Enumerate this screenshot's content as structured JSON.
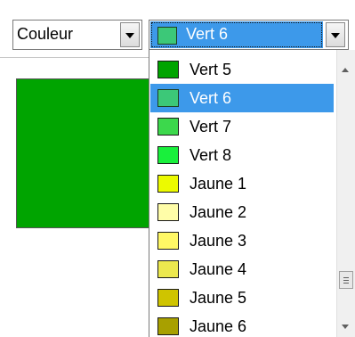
{
  "mode_select": {
    "value": "Couleur"
  },
  "color_select": {
    "value": "Vert 6",
    "swatch": "#3cc878"
  },
  "preview": {
    "color": "#00a400"
  },
  "dropdown": {
    "selected_index": 1,
    "selection_color": "#3d99ea",
    "items": [
      {
        "label": "Vert 5",
        "color": "#00a400"
      },
      {
        "label": "Vert 6",
        "color": "#3cc878"
      },
      {
        "label": "Vert 7",
        "color": "#3cd84c"
      },
      {
        "label": "Vert 8",
        "color": "#19f03c"
      },
      {
        "label": "Jaune 1",
        "color": "#ecfa00"
      },
      {
        "label": "Jaune 2",
        "color": "#fffda8"
      },
      {
        "label": "Jaune 3",
        "color": "#fff865"
      },
      {
        "label": "Jaune 4",
        "color": "#ece84e"
      },
      {
        "label": "Jaune 5",
        "color": "#cfc400"
      },
      {
        "label": "Jaune 6",
        "color": "#a8a000"
      }
    ]
  }
}
